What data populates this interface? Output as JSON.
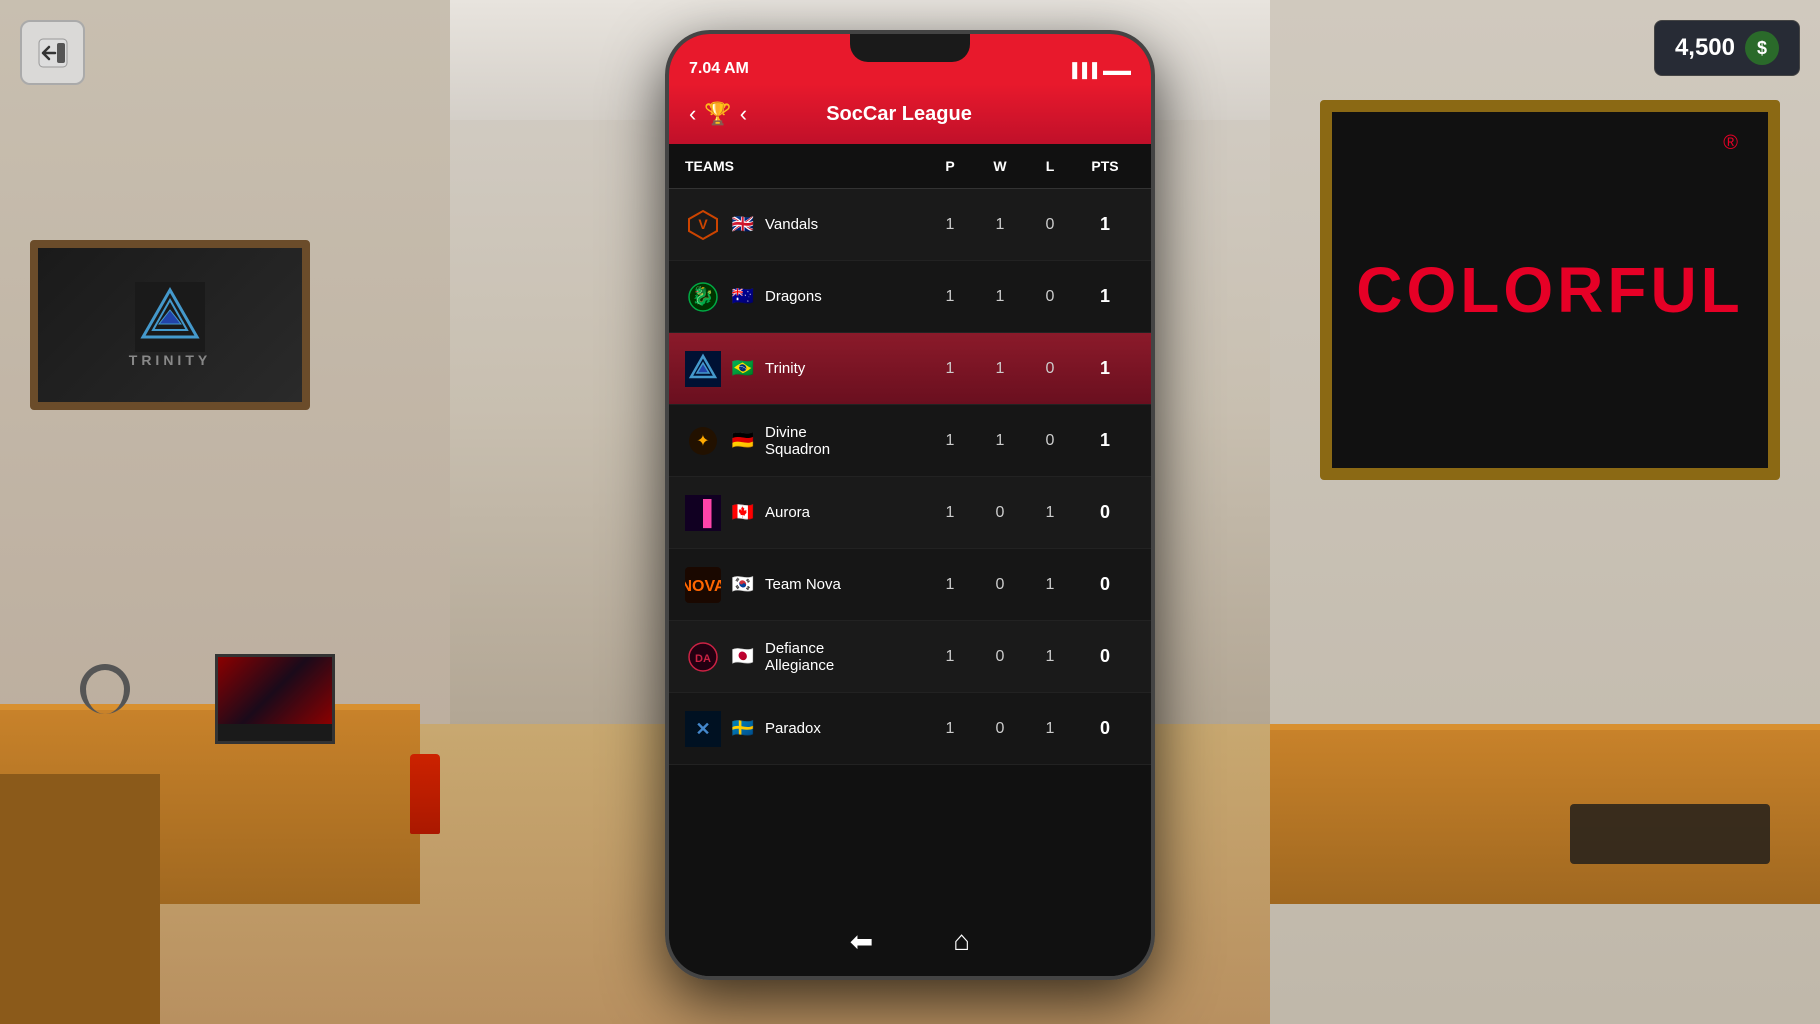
{
  "ui": {
    "exit_button_icon": "↩",
    "currency": {
      "amount": "4,500",
      "icon": "$"
    }
  },
  "status_bar": {
    "time": "7.04 AM",
    "signal_icon": "📶",
    "battery_icon": "🔋"
  },
  "header": {
    "back_icon": "‹",
    "trophy_icon": "🏆",
    "close_icon": "‹",
    "title": "SocCar League"
  },
  "table": {
    "columns": [
      "TEAMS",
      "P",
      "W",
      "L",
      "PTS"
    ],
    "teams": [
      {
        "name": "Vandals",
        "flag": "🇬🇧",
        "logo": "⚡",
        "logo_color": "#cc4400",
        "p": "1",
        "w": "1",
        "l": "0",
        "pts": "1",
        "highlighted": false
      },
      {
        "name": "Dragons",
        "flag": "🇦🇺",
        "logo": "🐉",
        "logo_color": "#00aa44",
        "p": "1",
        "w": "1",
        "l": "0",
        "pts": "1",
        "highlighted": false
      },
      {
        "name": "Trinity",
        "flag": "🇧🇷",
        "logo": "△",
        "logo_color": "#44aacc",
        "p": "1",
        "w": "1",
        "l": "0",
        "pts": "1",
        "highlighted": true
      },
      {
        "name": "Divine\nSquadron",
        "flag": "🇩🇪",
        "logo": "✦",
        "logo_color": "#ffaa00",
        "p": "1",
        "w": "1",
        "l": "0",
        "pts": "1",
        "highlighted": false
      },
      {
        "name": "Aurora",
        "flag": "🇨🇦",
        "logo": "▌",
        "logo_color": "#ff44aa",
        "p": "1",
        "w": "0",
        "l": "1",
        "pts": "0",
        "highlighted": false
      },
      {
        "name": "Team Nova",
        "flag": "🇰🇷",
        "logo": "N",
        "logo_color": "#ff6600",
        "p": "1",
        "w": "0",
        "l": "1",
        "pts": "0",
        "highlighted": false
      },
      {
        "name": "Defiance\nAllegiance",
        "flag": "🇯🇵",
        "logo": "DA",
        "logo_color": "#cc2244",
        "p": "1",
        "w": "0",
        "l": "1",
        "pts": "0",
        "highlighted": false
      },
      {
        "name": "Paradox",
        "flag": "🇸🇪",
        "logo": "✕",
        "logo_color": "#4488cc",
        "p": "1",
        "w": "0",
        "l": "1",
        "pts": "0",
        "highlighted": false
      }
    ]
  },
  "bottom_nav": {
    "back_icon": "⬅",
    "home_icon": "⌂"
  },
  "room": {
    "colorful_text": "COLORFUL",
    "trinity_text": "TRINITY"
  }
}
